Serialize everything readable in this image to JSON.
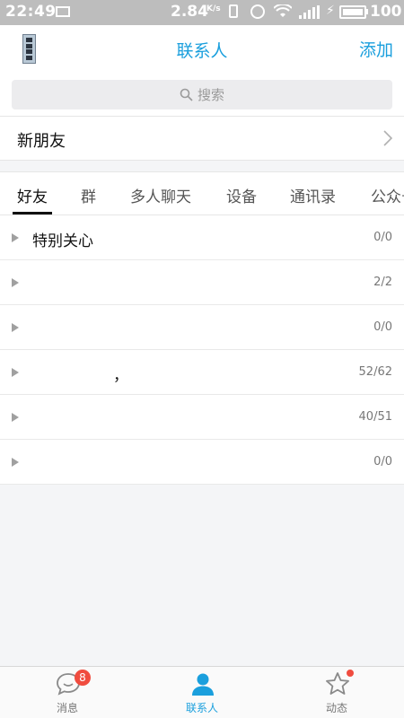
{
  "status_bar": {
    "time": "22:49",
    "speed": "2.84",
    "speed_unit": "K/s",
    "battery": "100"
  },
  "header": {
    "title": "联系人",
    "add_label": "添加"
  },
  "search": {
    "placeholder": "搜索"
  },
  "new_friends": {
    "label": "新朋友"
  },
  "tabs": [
    {
      "label": "好友"
    },
    {
      "label": "群"
    },
    {
      "label": "多人聊天"
    },
    {
      "label": "设备"
    },
    {
      "label": "通讯录"
    },
    {
      "label": "公众号"
    }
  ],
  "groups": [
    {
      "name": "特别关心",
      "count": "0/0"
    },
    {
      "name": "",
      "count": "2/2"
    },
    {
      "name": "",
      "count": "0/0"
    },
    {
      "name": "，",
      "count": "52/62"
    },
    {
      "name": "",
      "count": "40/51"
    },
    {
      "name": "",
      "count": "0/0"
    }
  ],
  "bottom_nav": {
    "messages_label": "消息",
    "messages_badge": "8",
    "contacts_label": "联系人",
    "moments_label": "动态"
  },
  "colors": {
    "accent": "#1a9fdd",
    "badge": "#f04c3f"
  }
}
